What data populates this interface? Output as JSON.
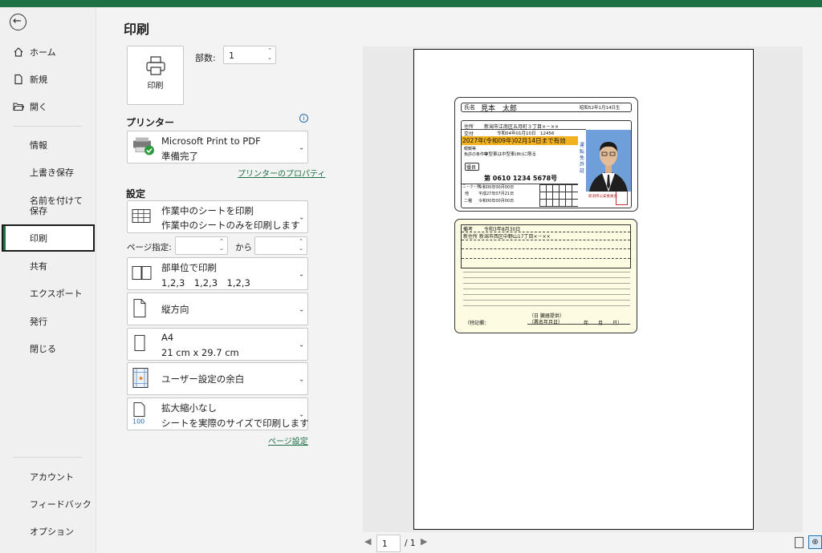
{
  "nav": {
    "home": "ホーム",
    "new": "新規",
    "open": "開く",
    "info": "情報",
    "save": "上書き保存",
    "save_as": "名前を付けて保存",
    "print": "印刷",
    "share": "共有",
    "export": "エクスポート",
    "publish": "発行",
    "close": "閉じる",
    "account": "アカウント",
    "feedback": "フィードバック",
    "options": "オプション"
  },
  "print": {
    "title": "印刷",
    "button_label": "印刷",
    "copies_label": "部数:",
    "copies_value": "1"
  },
  "printer": {
    "section": "プリンター",
    "name": "Microsoft Print to PDF",
    "status": "準備完了",
    "properties_link": "プリンターのプロパティ"
  },
  "settings": {
    "section": "設定",
    "scope_title": "作業中のシートを印刷",
    "scope_desc": "作業中のシートのみを印刷します",
    "pages_label": "ページ指定:",
    "pages_from": "",
    "to_label": "から",
    "pages_to": "",
    "collate_title": "部単位で印刷",
    "collate_desc": "1,2,3　1,2,3　1,2,3",
    "orientation": "縦方向",
    "paper_title": "A4",
    "paper_desc": "21 cm x 29.7 cm",
    "margins": "ユーザー設定の余白",
    "scaling_title": "拡大縮小なし",
    "scaling_desc": "シートを実際のサイズで印刷します",
    "scaling_badge": "100",
    "page_setup_link": "ページ設定"
  },
  "preview": {
    "page_current": "1",
    "page_total": "/ 1",
    "front": {
      "name_label": "氏名",
      "name": "見本　太郎",
      "birth": "昭和52年1月14日生",
      "addr_label": "住所",
      "addr": "新潟市江南区五月町３丁目×－××",
      "issue_label": "交付",
      "issue": "令和04年01月10日　12456",
      "expiry": "2027年(令和09年)02月14日まで有効",
      "cond_label1": "眼鏡等",
      "cond_label2": "免許の条件等",
      "cond": "中型車は中型車(8t)に限る",
      "valid_label": "優良",
      "number": "第 0610 1234 5678号",
      "side_text": "運転免許証",
      "side_auth": "新潟県公安委員会",
      "row_labels": [
        "二・小・原",
        "他",
        "二種"
      ],
      "row_dates": [
        "令和00年00月00日",
        "平成27年07月21日",
        "令和00年00月00日"
      ]
    },
    "back": {
      "remarks_label": "備考",
      "remarks_date": "令和3年8月30日",
      "new_addr": "新住所 新潟市西区中野山17丁目×－××",
      "organ_title": "（日 臓器提供）",
      "sign_label": "（署名年月日）",
      "special_label": "（特記欄：",
      "date_label": "年　　月　　日）"
    }
  }
}
